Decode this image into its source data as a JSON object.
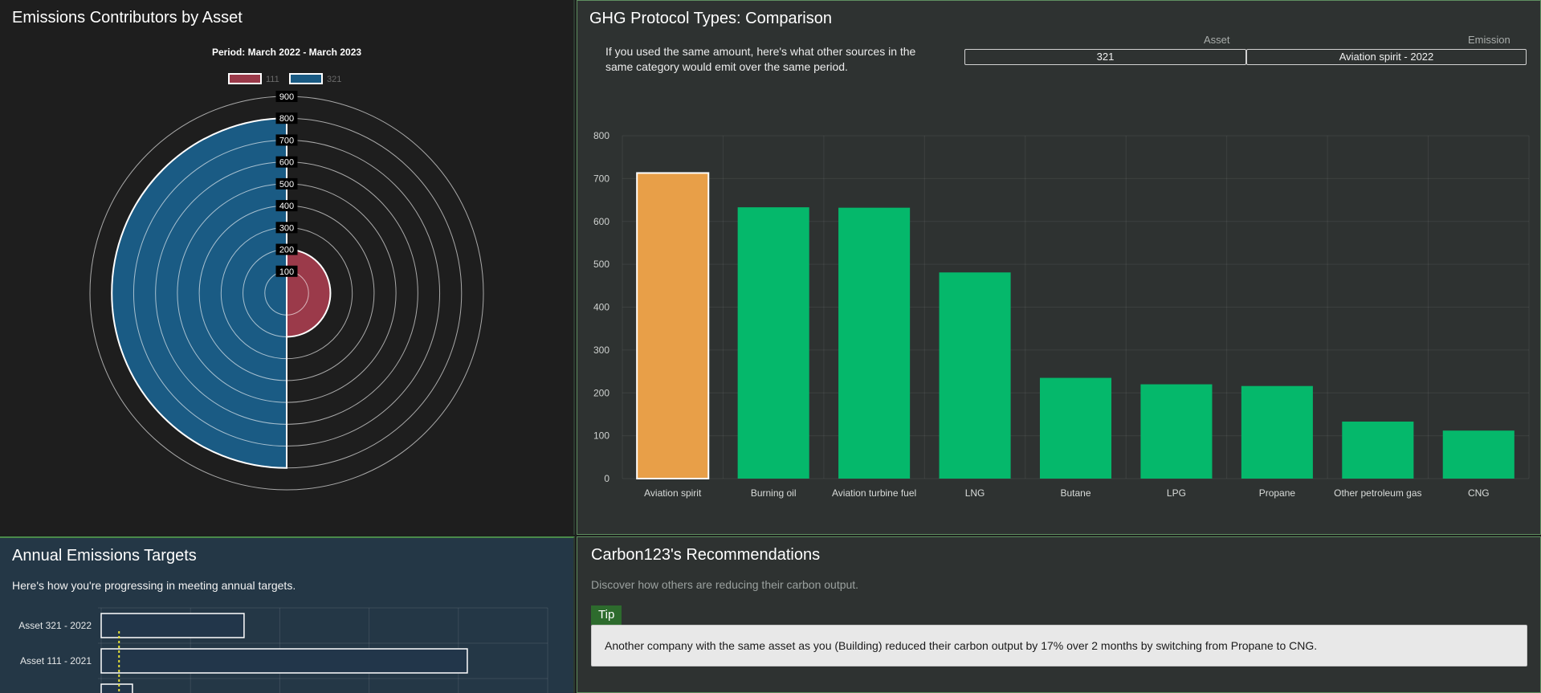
{
  "panels": {
    "contributors": {
      "title": "Emissions Contributors by Asset"
    },
    "comparison": {
      "title": "GHG Protocol Types: Comparison",
      "intro": "If you used the same amount, here's what other sources in the same category would emit over the same period.",
      "asset_label": "Asset",
      "emission_label": "Emission",
      "asset_value": "321",
      "emission_value": "Aviation spirit - 2022"
    },
    "targets": {
      "title": "Annual Emissions Targets",
      "subtitle": "Here's how you're progressing in meeting annual targets."
    },
    "recommendations": {
      "title": "Carbon123's Recommendations",
      "subtitle": "Discover how others are reducing their carbon output.",
      "tip_label": "Tip",
      "tip_text": "Another company with the same asset as you (Building) reduced their carbon output by 17% over 2 months by switching from Propane to CNG."
    }
  },
  "chart_data": [
    {
      "type": "polar-area",
      "title": "Period: March 2022 - March 2023",
      "categories": [
        "111",
        "321"
      ],
      "values": [
        200,
        800
      ],
      "colors": [
        "#9b3a4a",
        "#1a5b84"
      ],
      "legend": "top",
      "rlim": [
        0,
        900
      ],
      "rticks": [
        100,
        200,
        300,
        400,
        500,
        600,
        700,
        800,
        900
      ]
    },
    {
      "type": "bar",
      "categories": [
        "Aviation spirit",
        "Burning oil",
        "Aviation turbine fuel",
        "LNG",
        "Butane",
        "LPG",
        "Propane",
        "Other petroleum gas",
        "CNG"
      ],
      "values": [
        713,
        633,
        632,
        481,
        235,
        220,
        216,
        133,
        112
      ],
      "highlight": "Aviation spirit",
      "colors": {
        "highlight": "#e89f48",
        "default": "#05b86b"
      },
      "ylim": [
        0,
        800
      ],
      "yticks": [
        0,
        100,
        200,
        300,
        400,
        500,
        600,
        700,
        800
      ],
      "grid": true
    },
    {
      "type": "bar",
      "orientation": "horizontal",
      "categories": [
        "Asset 321 - 2022",
        "Asset 111 - 2021",
        ""
      ],
      "values": [
        160,
        410,
        35
      ],
      "target_marker": 20,
      "xlim": [
        0,
        500
      ],
      "grid": true
    }
  ]
}
